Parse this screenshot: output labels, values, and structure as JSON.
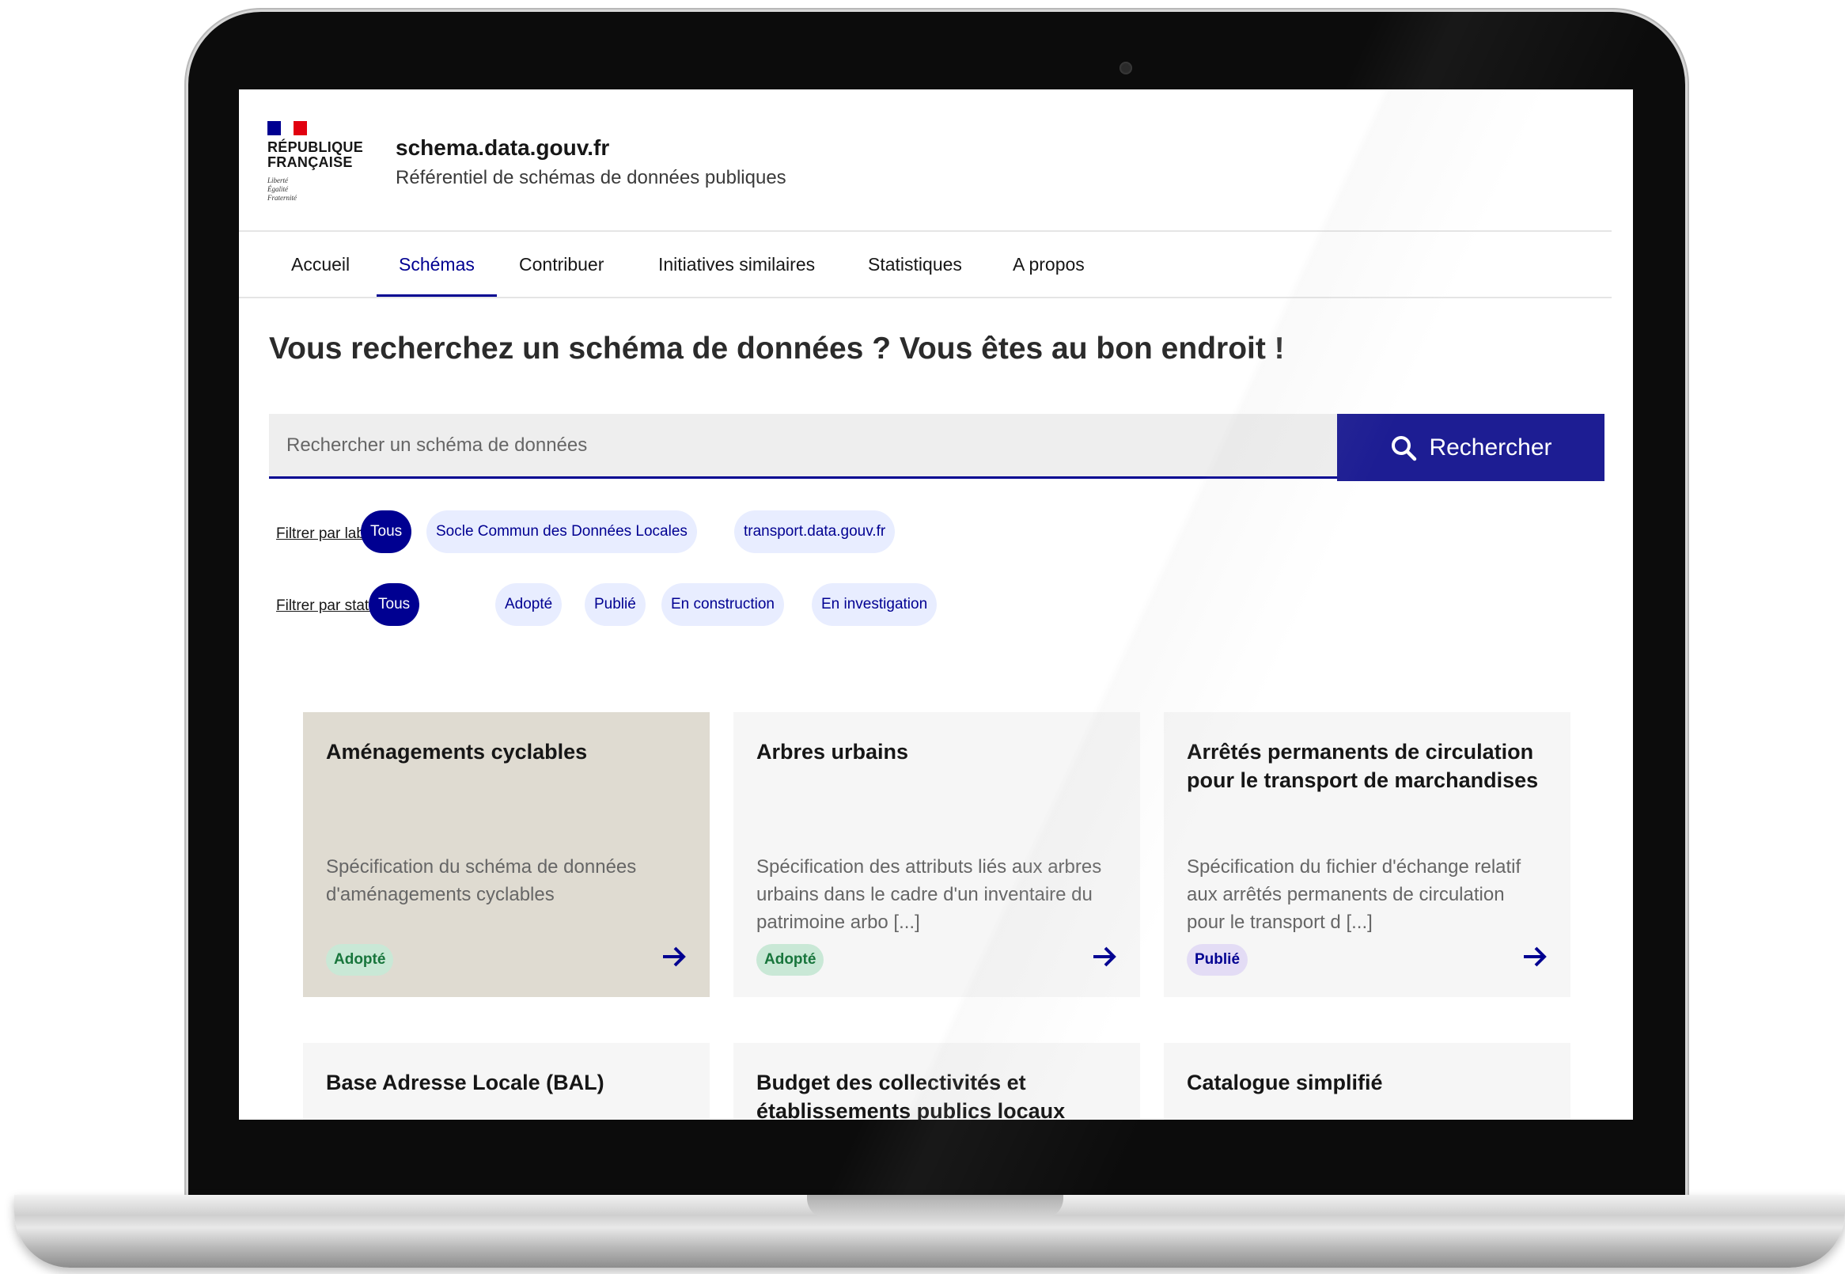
{
  "brand": {
    "republique_lines": [
      "RÉPUBLIQUE",
      "FRANÇAISE"
    ],
    "devise_lines": [
      "Liberté",
      "Égalité",
      "Fraternité"
    ],
    "flag_colors": [
      "#000091",
      "#ffffff",
      "#e1000f"
    ]
  },
  "header": {
    "site_title": "schema.data.gouv.fr",
    "tagline": "Référentiel de schémas de données publiques"
  },
  "nav": {
    "items": [
      {
        "label": "Accueil"
      },
      {
        "label": "Schémas",
        "active": true
      },
      {
        "label": "Contribuer"
      },
      {
        "label": "Initiatives similaires"
      },
      {
        "label": "Statistiques"
      },
      {
        "label": "A propos"
      }
    ]
  },
  "hero": {
    "title": "Vous recherchez un schéma de données ? Vous êtes au bon endroit !"
  },
  "search": {
    "placeholder": "Rechercher un schéma de données",
    "value": "",
    "button_label": "Rechercher",
    "icon": "search-icon"
  },
  "filters": {
    "label_filter": {
      "title": "Filtrer par label :",
      "chips": [
        {
          "label": "Tous",
          "selected": true
        },
        {
          "label": "Socle Commun des Données Locales"
        },
        {
          "label": "transport.data.gouv.fr"
        }
      ]
    },
    "status_filter": {
      "title": "Filtrer par statut :",
      "chips": [
        {
          "label": "Tous",
          "selected": true
        },
        {
          "label": "Adopté"
        },
        {
          "label": "Publié"
        },
        {
          "label": "En construction"
        },
        {
          "label": "En investigation"
        }
      ]
    }
  },
  "cards": [
    {
      "title": "Aménagements cyclables",
      "description": "Spécification du schéma de données d'aménagements cyclables",
      "status": "Adopté"
    },
    {
      "title": "Arbres urbains",
      "description": "Spécification des attributs liés aux arbres urbains dans le cadre d'un inventaire du patrimoine arbo [...]",
      "status": "Adopté"
    },
    {
      "title": "Arrêtés permanents de circulation pour le transport de marchandises",
      "description": "Spécification du fichier d'échange relatif aux arrêtés permanents de circulation pour le transport d [...]",
      "status": "Publié"
    },
    {
      "title": "Base Adresse Locale (BAL)"
    },
    {
      "title": "Budget des collectivités et établissements publics locaux"
    },
    {
      "title": "Catalogue simplifié"
    }
  ],
  "colors": {
    "accent": "#000091",
    "featured_card_bg": "#dfdbd1",
    "card_bg": "#f6f6f6",
    "badge_adopte_bg": "#c9e8d6",
    "badge_publie_bg": "#e3dcf5"
  }
}
